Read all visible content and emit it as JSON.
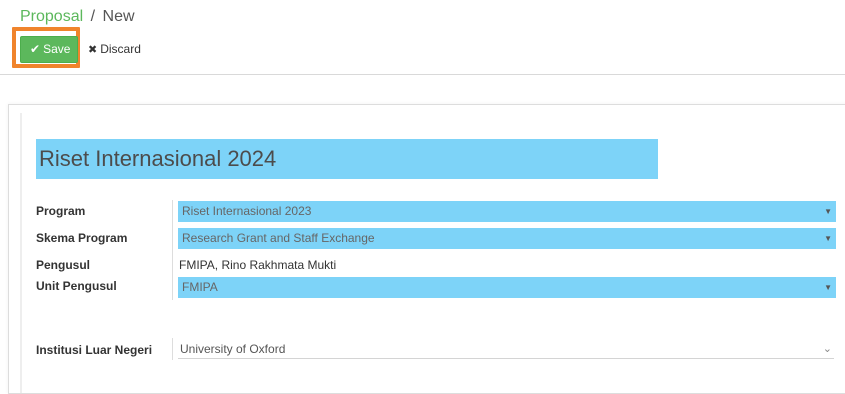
{
  "breadcrumb": {
    "parent": "Proposal",
    "separator": "/",
    "current": "New"
  },
  "toolbar": {
    "save_label": "Save",
    "discard_label": "Discard"
  },
  "form": {
    "title": "Riset Internasional 2024",
    "fields": {
      "program": {
        "label": "Program",
        "value": "Riset Internasional 2023"
      },
      "skema": {
        "label": "Skema Program",
        "value": "Research Grant and Staff Exchange"
      },
      "pengusul": {
        "label": "Pengusul",
        "value": "FMIPA, Rino Rakhmata Mukti"
      },
      "unit": {
        "label": "Unit Pengusul",
        "value": "FMIPA"
      },
      "institusi": {
        "label": "Institusi Luar Negeri",
        "value": "University of Oxford"
      }
    }
  },
  "colors": {
    "accent_green": "#5cb85c",
    "field_highlight": "#7dd3f8",
    "focus_outline": "#f0842c"
  }
}
